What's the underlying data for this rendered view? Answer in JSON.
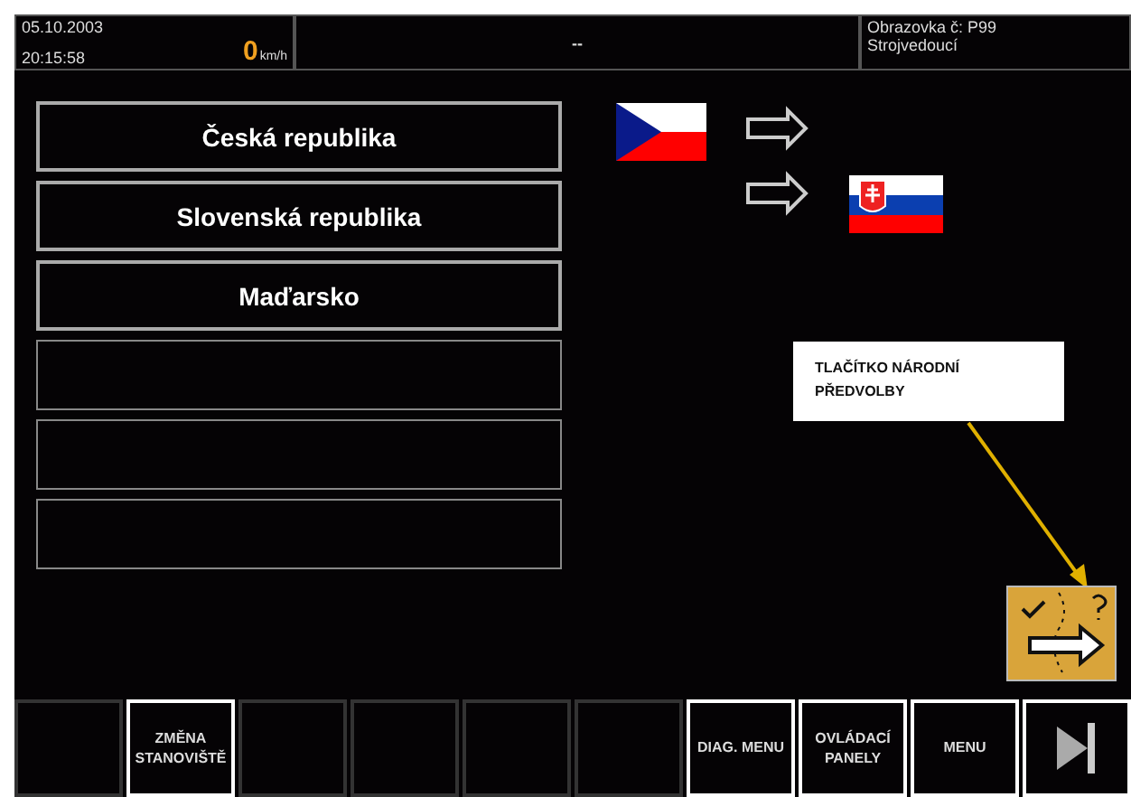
{
  "header": {
    "date": "05.10.2003",
    "time": "20:15:58",
    "speed": "0",
    "speed_unit": "km/h",
    "center": "--",
    "screen": "Obrazovka č: P99",
    "role": "Strojvedoucí"
  },
  "country_buttons": [
    {
      "kind": "text",
      "label": "Česká republika"
    },
    {
      "kind": "text",
      "label": "Slovenská republika"
    },
    {
      "kind": "text",
      "label": "Maďarsko"
    },
    {
      "kind": "empty"
    },
    {
      "kind": "empty"
    },
    {
      "kind": "empty"
    }
  ],
  "callout": {
    "text": "TLAČÍTKO NÁRODNÍ PŘEDVOLBY"
  },
  "softkeys": [
    {
      "kind": "empty",
      "enabled": false
    },
    {
      "kind": "text",
      "label": "ZMĚNA STANOVIŠTĚ",
      "enabled": true
    },
    {
      "kind": "empty",
      "enabled": false
    },
    {
      "kind": "empty",
      "enabled": false
    },
    {
      "kind": "empty",
      "enabled": false
    },
    {
      "kind": "empty",
      "enabled": false
    },
    {
      "kind": "text",
      "label": "DIAG. MENU",
      "enabled": true
    },
    {
      "kind": "text",
      "label": "OVLÁDACÍ PANELY",
      "enabled": true
    },
    {
      "kind": "text",
      "label": "MENU",
      "enabled": true
    },
    {
      "kind": "icon",
      "enabled": true
    }
  ]
}
